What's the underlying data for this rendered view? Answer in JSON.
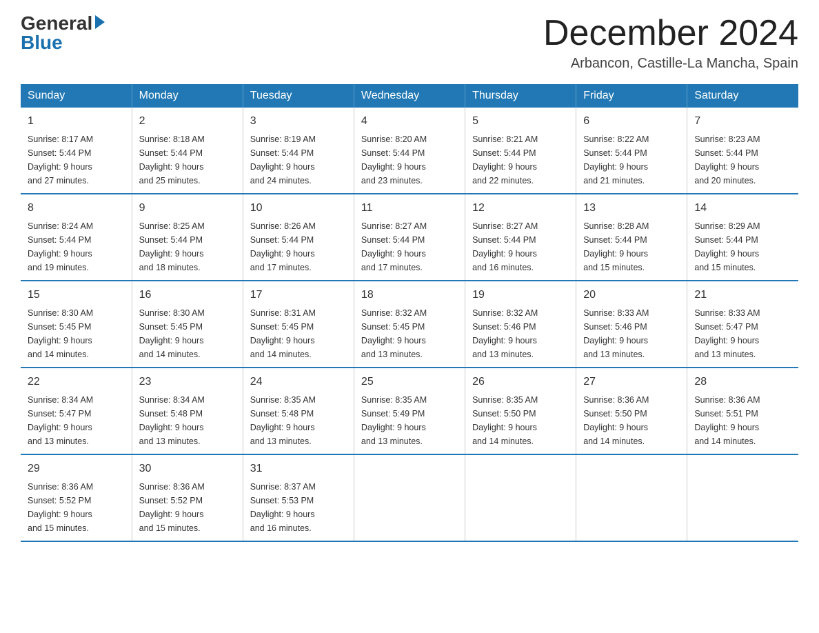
{
  "header": {
    "logo": {
      "general": "General",
      "blue": "Blue",
      "tagline": "GeneralBlue"
    },
    "title": "December 2024",
    "location": "Arbancon, Castille-La Mancha, Spain"
  },
  "days_of_week": [
    "Sunday",
    "Monday",
    "Tuesday",
    "Wednesday",
    "Thursday",
    "Friday",
    "Saturday"
  ],
  "weeks": [
    [
      {
        "day": "1",
        "sunrise": "8:17 AM",
        "sunset": "5:44 PM",
        "daylight": "9 hours and 27 minutes."
      },
      {
        "day": "2",
        "sunrise": "8:18 AM",
        "sunset": "5:44 PM",
        "daylight": "9 hours and 25 minutes."
      },
      {
        "day": "3",
        "sunrise": "8:19 AM",
        "sunset": "5:44 PM",
        "daylight": "9 hours and 24 minutes."
      },
      {
        "day": "4",
        "sunrise": "8:20 AM",
        "sunset": "5:44 PM",
        "daylight": "9 hours and 23 minutes."
      },
      {
        "day": "5",
        "sunrise": "8:21 AM",
        "sunset": "5:44 PM",
        "daylight": "9 hours and 22 minutes."
      },
      {
        "day": "6",
        "sunrise": "8:22 AM",
        "sunset": "5:44 PM",
        "daylight": "9 hours and 21 minutes."
      },
      {
        "day": "7",
        "sunrise": "8:23 AM",
        "sunset": "5:44 PM",
        "daylight": "9 hours and 20 minutes."
      }
    ],
    [
      {
        "day": "8",
        "sunrise": "8:24 AM",
        "sunset": "5:44 PM",
        "daylight": "9 hours and 19 minutes."
      },
      {
        "day": "9",
        "sunrise": "8:25 AM",
        "sunset": "5:44 PM",
        "daylight": "9 hours and 18 minutes."
      },
      {
        "day": "10",
        "sunrise": "8:26 AM",
        "sunset": "5:44 PM",
        "daylight": "9 hours and 17 minutes."
      },
      {
        "day": "11",
        "sunrise": "8:27 AM",
        "sunset": "5:44 PM",
        "daylight": "9 hours and 17 minutes."
      },
      {
        "day": "12",
        "sunrise": "8:27 AM",
        "sunset": "5:44 PM",
        "daylight": "9 hours and 16 minutes."
      },
      {
        "day": "13",
        "sunrise": "8:28 AM",
        "sunset": "5:44 PM",
        "daylight": "9 hours and 15 minutes."
      },
      {
        "day": "14",
        "sunrise": "8:29 AM",
        "sunset": "5:44 PM",
        "daylight": "9 hours and 15 minutes."
      }
    ],
    [
      {
        "day": "15",
        "sunrise": "8:30 AM",
        "sunset": "5:45 PM",
        "daylight": "9 hours and 14 minutes."
      },
      {
        "day": "16",
        "sunrise": "8:30 AM",
        "sunset": "5:45 PM",
        "daylight": "9 hours and 14 minutes."
      },
      {
        "day": "17",
        "sunrise": "8:31 AM",
        "sunset": "5:45 PM",
        "daylight": "9 hours and 14 minutes."
      },
      {
        "day": "18",
        "sunrise": "8:32 AM",
        "sunset": "5:45 PM",
        "daylight": "9 hours and 13 minutes."
      },
      {
        "day": "19",
        "sunrise": "8:32 AM",
        "sunset": "5:46 PM",
        "daylight": "9 hours and 13 minutes."
      },
      {
        "day": "20",
        "sunrise": "8:33 AM",
        "sunset": "5:46 PM",
        "daylight": "9 hours and 13 minutes."
      },
      {
        "day": "21",
        "sunrise": "8:33 AM",
        "sunset": "5:47 PM",
        "daylight": "9 hours and 13 minutes."
      }
    ],
    [
      {
        "day": "22",
        "sunrise": "8:34 AM",
        "sunset": "5:47 PM",
        "daylight": "9 hours and 13 minutes."
      },
      {
        "day": "23",
        "sunrise": "8:34 AM",
        "sunset": "5:48 PM",
        "daylight": "9 hours and 13 minutes."
      },
      {
        "day": "24",
        "sunrise": "8:35 AM",
        "sunset": "5:48 PM",
        "daylight": "9 hours and 13 minutes."
      },
      {
        "day": "25",
        "sunrise": "8:35 AM",
        "sunset": "5:49 PM",
        "daylight": "9 hours and 13 minutes."
      },
      {
        "day": "26",
        "sunrise": "8:35 AM",
        "sunset": "5:50 PM",
        "daylight": "9 hours and 14 minutes."
      },
      {
        "day": "27",
        "sunrise": "8:36 AM",
        "sunset": "5:50 PM",
        "daylight": "9 hours and 14 minutes."
      },
      {
        "day": "28",
        "sunrise": "8:36 AM",
        "sunset": "5:51 PM",
        "daylight": "9 hours and 14 minutes."
      }
    ],
    [
      {
        "day": "29",
        "sunrise": "8:36 AM",
        "sunset": "5:52 PM",
        "daylight": "9 hours and 15 minutes."
      },
      {
        "day": "30",
        "sunrise": "8:36 AM",
        "sunset": "5:52 PM",
        "daylight": "9 hours and 15 minutes."
      },
      {
        "day": "31",
        "sunrise": "8:37 AM",
        "sunset": "5:53 PM",
        "daylight": "9 hours and 16 minutes."
      },
      null,
      null,
      null,
      null
    ]
  ],
  "labels": {
    "sunrise": "Sunrise:",
    "sunset": "Sunset:",
    "daylight": "Daylight:"
  }
}
